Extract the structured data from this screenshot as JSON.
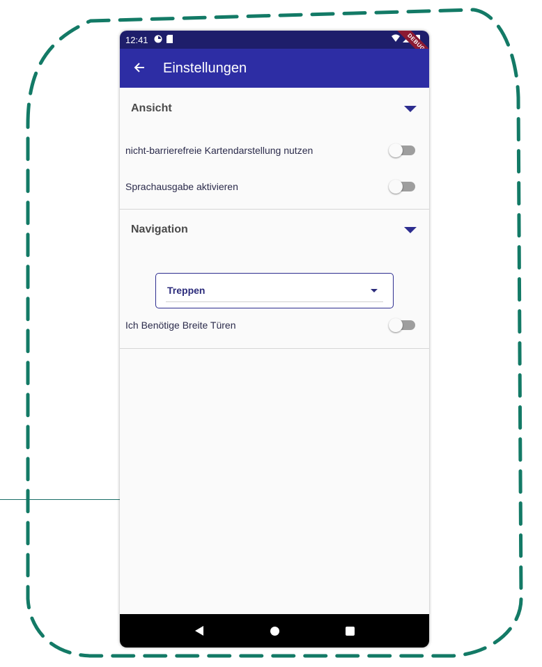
{
  "status_bar": {
    "time": "12:41"
  },
  "debug_banner": "DEBUG",
  "app_bar": {
    "title": "Einstellungen"
  },
  "sections": [
    {
      "title": "Ansicht",
      "expanded": true,
      "settings": [
        {
          "label": "nicht-barrierefreie Kartendarstellung nutzen",
          "enabled": false
        },
        {
          "label": "Sprachausgabe aktivieren",
          "enabled": false
        }
      ]
    },
    {
      "title": "Navigation",
      "expanded": true,
      "dropdown": {
        "selected": "Treppen"
      },
      "settings": [
        {
          "label": "Ich Benötige Breite Türen",
          "enabled": false
        }
      ]
    }
  ],
  "colors": {
    "app_bar": "#2d2da4",
    "status_bar": "#1e1e6b",
    "accent": "#2d2d8f",
    "frame_dash": "#137a66"
  }
}
